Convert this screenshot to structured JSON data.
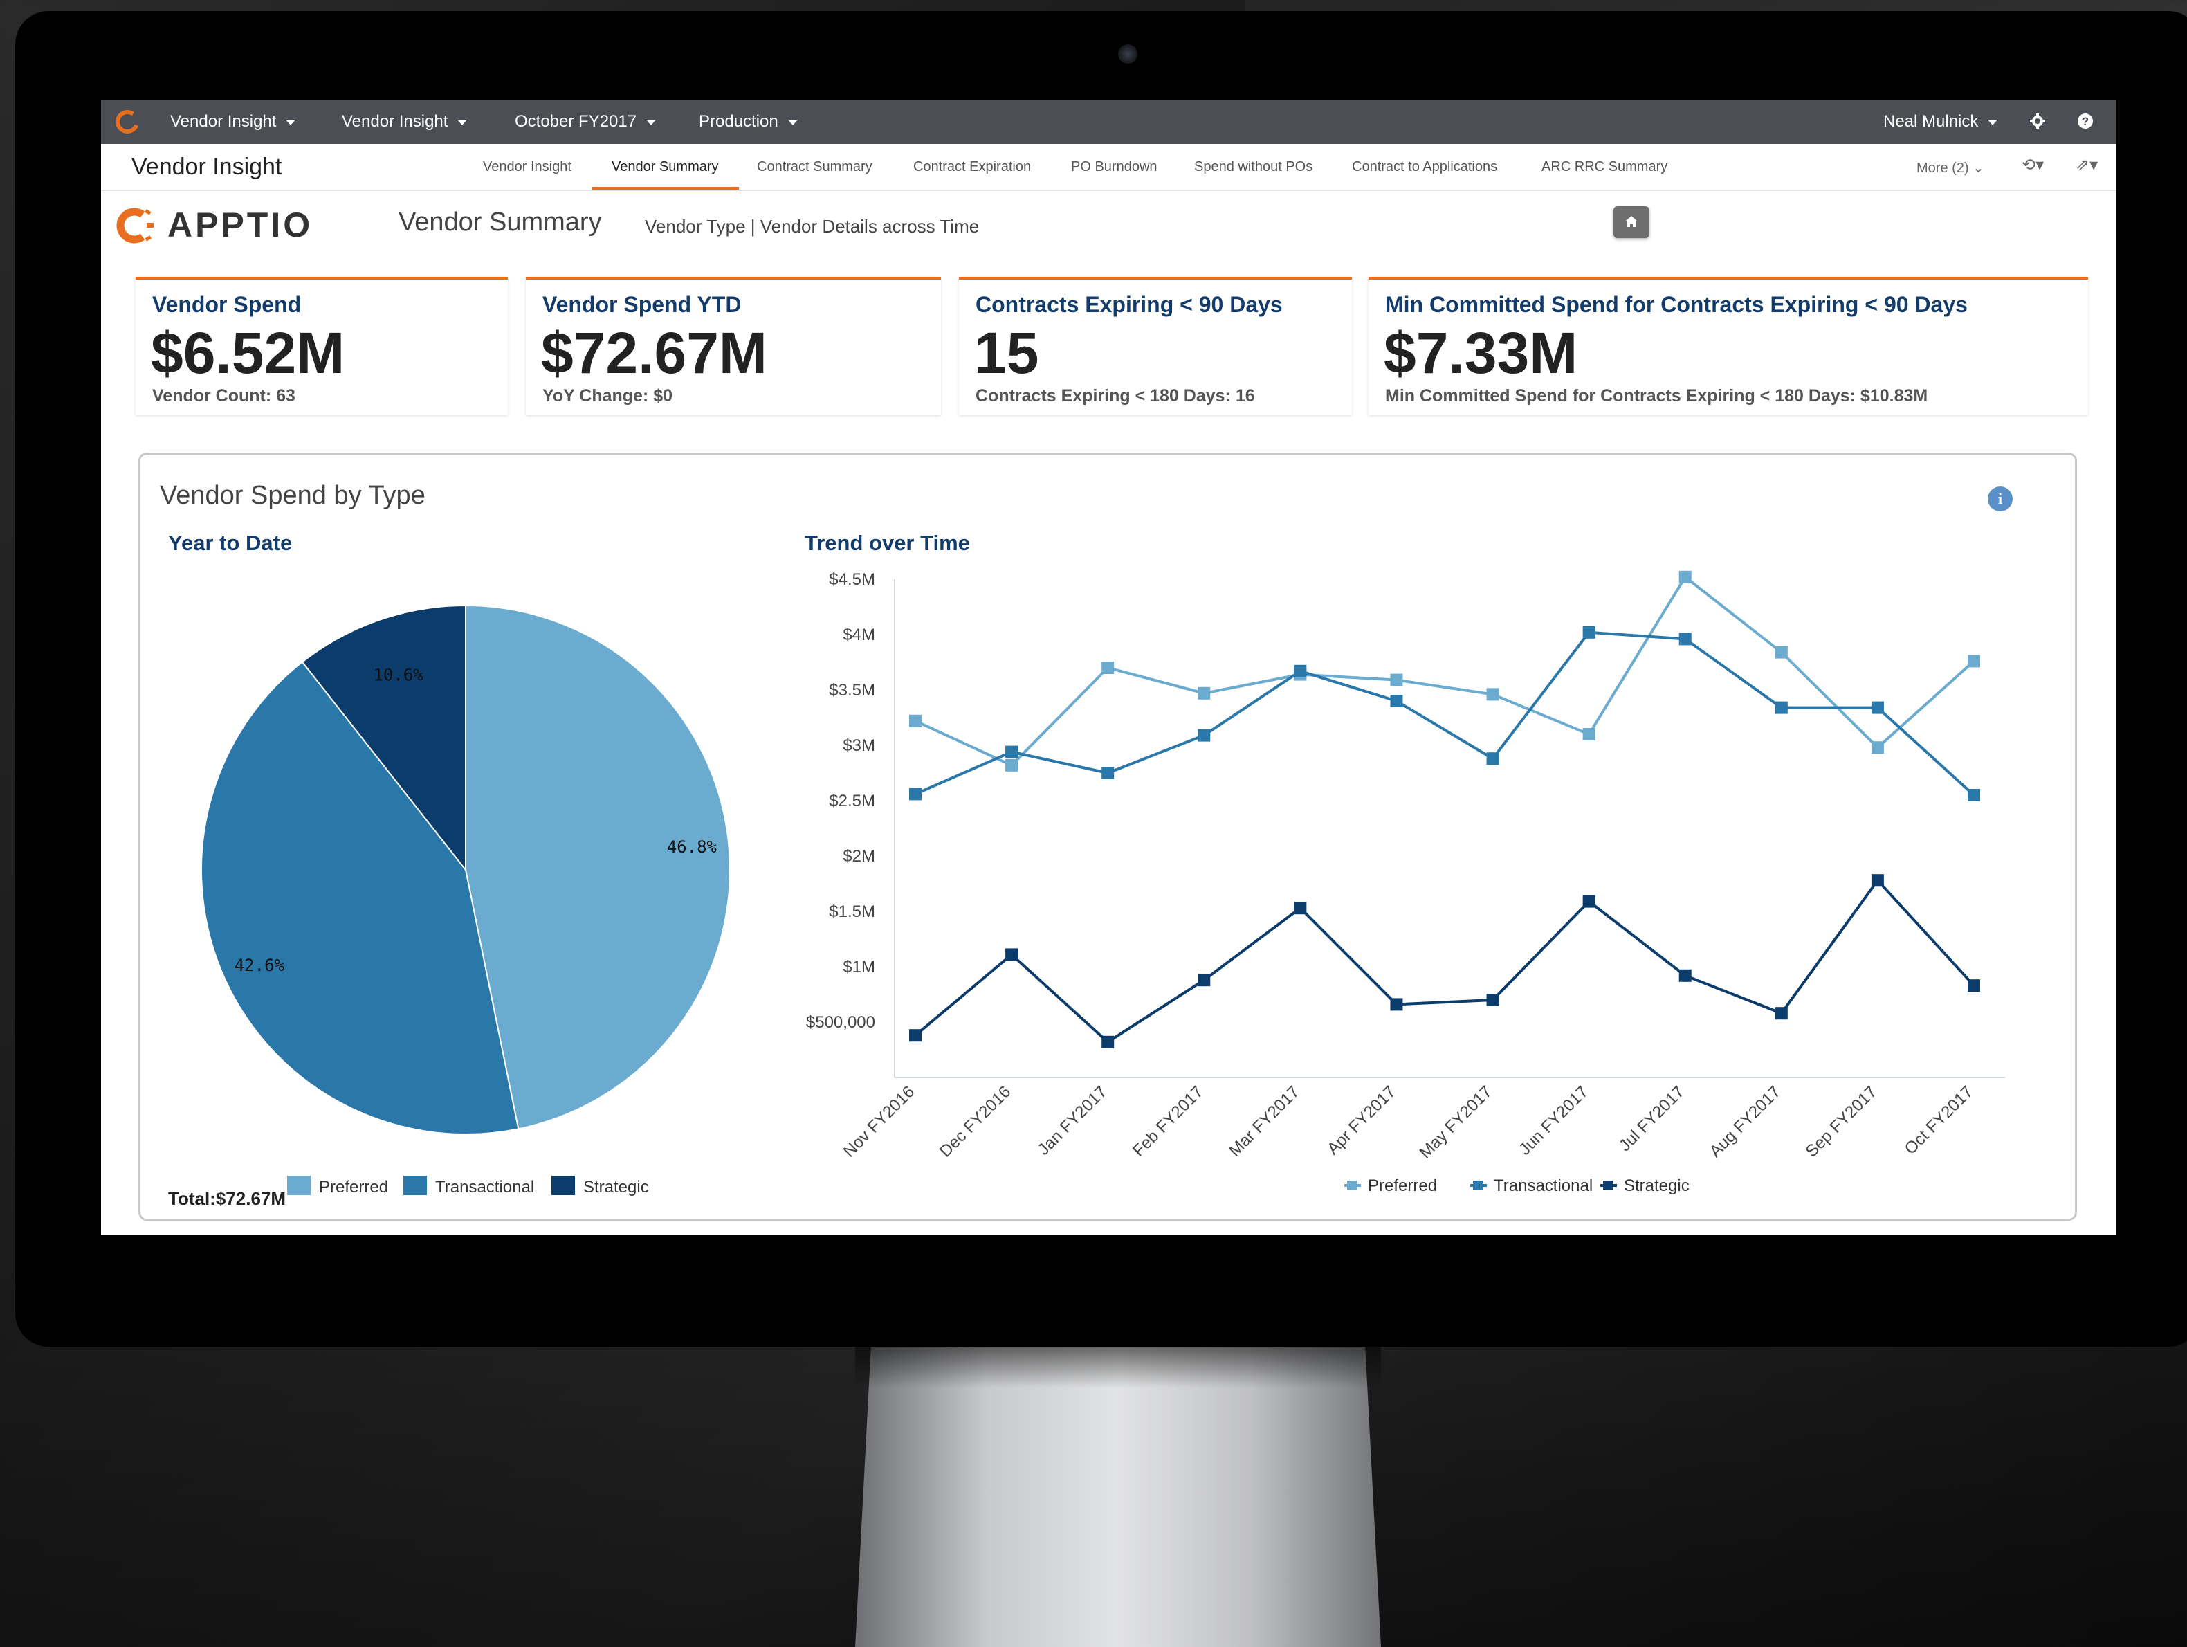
{
  "topbar": {
    "menus": [
      "Vendor Insight",
      "Vendor Insight",
      "October FY2017",
      "Production"
    ],
    "user": "Neal Mulnick"
  },
  "navbar": {
    "app_title": "Vendor Insight",
    "tabs": [
      "Vendor Insight",
      "Vendor Summary",
      "Contract Summary",
      "Contract Expiration",
      "PO Burndown",
      "Spend without POs",
      "Contract to Applications",
      "ARC RRC Summary"
    ],
    "active_tab": "Vendor Summary",
    "more": "More (2)"
  },
  "header": {
    "brand": "APPTIO",
    "page_title": "Vendor Summary",
    "page_subtitle": "Vendor Type | Vendor Details across Time"
  },
  "kpis": [
    {
      "title": "Vendor Spend",
      "value": "$6.52M",
      "footer": "Vendor Count: 63"
    },
    {
      "title": "Vendor Spend YTD",
      "value": "$72.67M",
      "footer": "YoY Change: $0"
    },
    {
      "title": "Contracts Expiring < 90 Days",
      "value": "15",
      "footer": "Contracts Expiring < 180 Days: 16"
    },
    {
      "title": "Min Committed Spend for Contracts Expiring < 90 Days",
      "value": "$7.33M",
      "footer": "Min Committed Spend for Contracts Expiring < 180 Days: $10.83M"
    }
  ],
  "panel": {
    "title": "Vendor Spend by Type",
    "left_title": "Year to Date",
    "right_title": "Trend over Time",
    "total": "Total:$72.67M"
  },
  "colors": {
    "preferred": "#6aabcf",
    "transactional": "#2a77aa",
    "strategic": "#0c3c6b",
    "accent": "#e86f1f"
  },
  "chart_data": [
    {
      "type": "pie",
      "title": "Year to Date",
      "categories": [
        "Preferred",
        "Transactional",
        "Strategic"
      ],
      "values": [
        46.8,
        42.6,
        10.6
      ],
      "labels": [
        "46.8%",
        "42.6%",
        "10.6%"
      ],
      "legend": "bottom"
    },
    {
      "type": "line",
      "title": "Trend over Time",
      "x": [
        "Nov FY2016",
        "Dec FY2016",
        "Jan FY2017",
        "Feb FY2017",
        "Mar FY2017",
        "Apr FY2017",
        "May FY2017",
        "Jun FY2017",
        "Jul FY2017",
        "Aug FY2017",
        "Sep FY2017",
        "Oct FY2017"
      ],
      "ylim": [
        0,
        4500000
      ],
      "yticks": [
        500000,
        1000000,
        1500000,
        2000000,
        2500000,
        3000000,
        3500000,
        4000000,
        4500000
      ],
      "ytick_labels": [
        "$500,000",
        "$1M",
        "$1.5M",
        "$2M",
        "$2.5M",
        "$3M",
        "$3.5M",
        "$4M",
        "$4.5M"
      ],
      "series": [
        {
          "name": "Preferred",
          "values": [
            3220000,
            2820000,
            3700000,
            3470000,
            3640000,
            3590000,
            3460000,
            3100000,
            4520000,
            3840000,
            2980000,
            3760000
          ]
        },
        {
          "name": "Transactional",
          "values": [
            2560000,
            2940000,
            2750000,
            3090000,
            3670000,
            3400000,
            2880000,
            4020000,
            3960000,
            3340000,
            3340000,
            2550000
          ]
        },
        {
          "name": "Strategic",
          "values": [
            380000,
            1110000,
            320000,
            880000,
            1530000,
            660000,
            700000,
            1590000,
            920000,
            580000,
            1780000,
            830000
          ]
        }
      ],
      "legend": "bottom"
    }
  ]
}
